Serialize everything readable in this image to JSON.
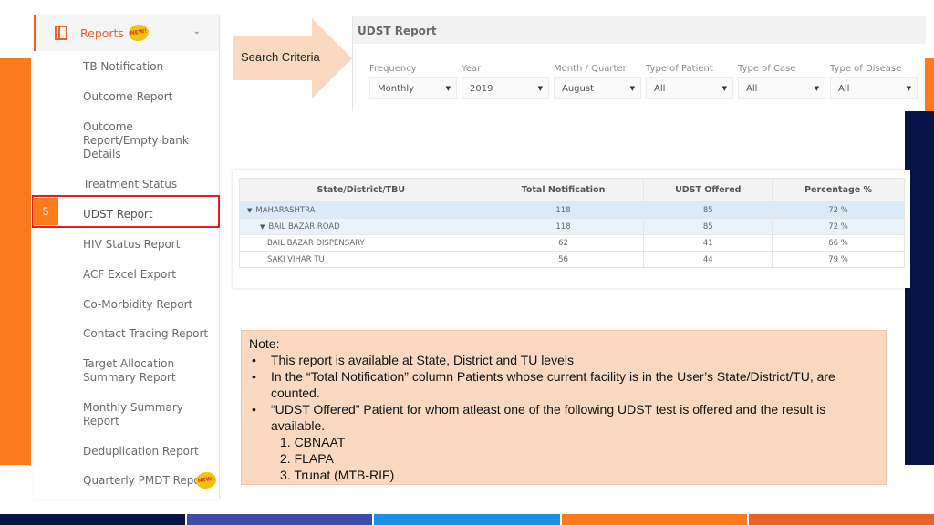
{
  "sidebar": {
    "header": {
      "title": "Reports",
      "badge": "NEW!"
    },
    "items": [
      {
        "label": "TB Notification"
      },
      {
        "label": "Outcome Report"
      },
      {
        "label": "Outcome Report/Empty bank Details"
      },
      {
        "label": "Treatment Status"
      },
      {
        "label": "UDST Report"
      },
      {
        "label": "HIV Status Report"
      },
      {
        "label": "ACF Excel Export"
      },
      {
        "label": "Co-Morbidity Report"
      },
      {
        "label": "Contact Tracing Report"
      },
      {
        "label": "Target Allocation Summary Report"
      },
      {
        "label": "Monthly Summary Report"
      },
      {
        "label": "Deduplication Report"
      },
      {
        "label": "Quarterly PMDT Report",
        "badge": "NEW!"
      }
    ],
    "step_number": "5"
  },
  "callout": {
    "label": "Search Criteria"
  },
  "report": {
    "title": "UDST Report",
    "filters": [
      {
        "label": "Frequency",
        "value": "Monthly"
      },
      {
        "label": "Year",
        "value": "2019"
      },
      {
        "label": "Month / Quarter",
        "value": "August"
      },
      {
        "label": "Type of Patient",
        "value": "All"
      },
      {
        "label": "Type of Case",
        "value": "All"
      },
      {
        "label": "Type of Disease",
        "value": "All"
      }
    ]
  },
  "table": {
    "headers": [
      "State/District/TBU",
      "Total Notification",
      "UDST Offered",
      "Percentage %"
    ],
    "rows": [
      {
        "name": "MAHARASHTRA",
        "total": "118",
        "offered": "85",
        "pct": "72 %"
      },
      {
        "name": "BAIL BAZAR ROAD",
        "total": "118",
        "offered": "85",
        "pct": "72 %"
      },
      {
        "name": "BAIL BAZAR DISPENSARY",
        "total": "62",
        "offered": "41",
        "pct": "66 %"
      },
      {
        "name": "SAKI VIHAR TU",
        "total": "56",
        "offered": "44",
        "pct": "79 %"
      }
    ]
  },
  "note": {
    "title": "Note:",
    "bullets": [
      "This report is available at State, District and TU levels",
      "In the “Total Notification” column Patients whose current facility is in the User’s State/District/TU, are counted.",
      "“UDST Offered” Patient for whom atleast one of the following UDST test is offered and the result is available."
    ],
    "tests": [
      "1.  CBNAAT",
      "2.  FLAPA",
      "3. Trunat (MTB-RIF)"
    ],
    "bullet_char": "•"
  },
  "colors": {
    "accent_orange": "#fb7a1c",
    "navy": "#071345",
    "highlight_red": "#e0201f",
    "note_bg": "#fad9c0",
    "bottom_strip": [
      "#071345",
      "#3d4aa8",
      "#1a8fe3",
      "#fb7a1c",
      "#e8622c"
    ]
  },
  "icons": {
    "sidebar_header": "document-icon",
    "collapse": "chevron-down-icon",
    "dropdown": "caret-down-icon",
    "expand": "triangle-down-icon"
  }
}
